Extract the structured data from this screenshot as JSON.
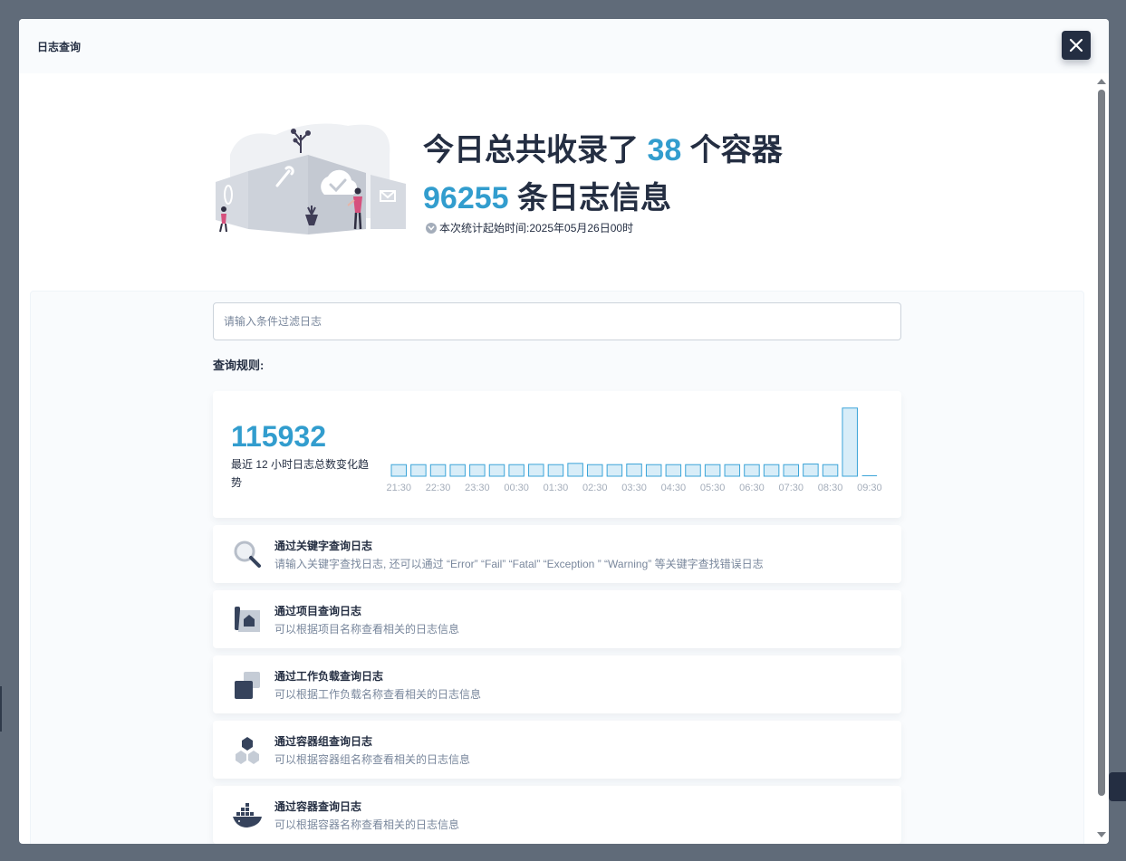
{
  "modal": {
    "title": "日志查询"
  },
  "hero": {
    "line1_prefix": "今日总共收录了 ",
    "container_count": "38",
    "line1_suffix": " 个容器",
    "log_count": "96255",
    "line2_suffix": " 条日志信息",
    "stat_start": "本次统计起始时间:2025年05月26日00时"
  },
  "search": {
    "placeholder": "请输入条件过滤日志",
    "value": ""
  },
  "rules": {
    "label": "查询规则:"
  },
  "stats": {
    "total": "115932",
    "description": "最近 12 小时日志总数变化趋势"
  },
  "chart_data": {
    "type": "bar",
    "tick_labels": [
      "21:30",
      "22:30",
      "23:30",
      "00:30",
      "01:30",
      "02:30",
      "03:30",
      "04:30",
      "05:30",
      "06:30",
      "07:30",
      "08:30",
      "09:30"
    ],
    "values": [
      3700,
      3700,
      3700,
      3700,
      3700,
      3700,
      3700,
      3800,
      3700,
      4100,
      3700,
      3700,
      3900,
      3700,
      3700,
      3700,
      3700,
      3700,
      3700,
      3700,
      3700,
      3900,
      3700,
      21800,
      0
    ],
    "ylim": [
      0,
      22000
    ],
    "grid": false,
    "bar_color": "#d8edf8",
    "bar_border": "#3ba4d8"
  },
  "query_cards": [
    {
      "icon": "magnifier-icon",
      "title": "通过关键字查询日志",
      "desc": "请输入关键字查找日志, 还可以通过 “Error” “Fail” “Fatal” “Exception ” “Warning” 等关键字查找错误日志"
    },
    {
      "icon": "project-icon",
      "title": "通过项目查询日志",
      "desc": "可以根据项目名称查看相关的日志信息"
    },
    {
      "icon": "workload-icon",
      "title": "通过工作负载查询日志",
      "desc": "可以根据工作负载名称查看相关的日志信息"
    },
    {
      "icon": "pod-icon",
      "title": "通过容器组查询日志",
      "desc": "可以根据容器组名称查看相关的日志信息"
    },
    {
      "icon": "docker-icon",
      "title": "通过容器查询日志",
      "desc": "可以根据容器名称查看相关的日志信息"
    }
  ],
  "colors": {
    "accent": "#329dce",
    "dark": "#242e42",
    "muted": "#79879c"
  }
}
